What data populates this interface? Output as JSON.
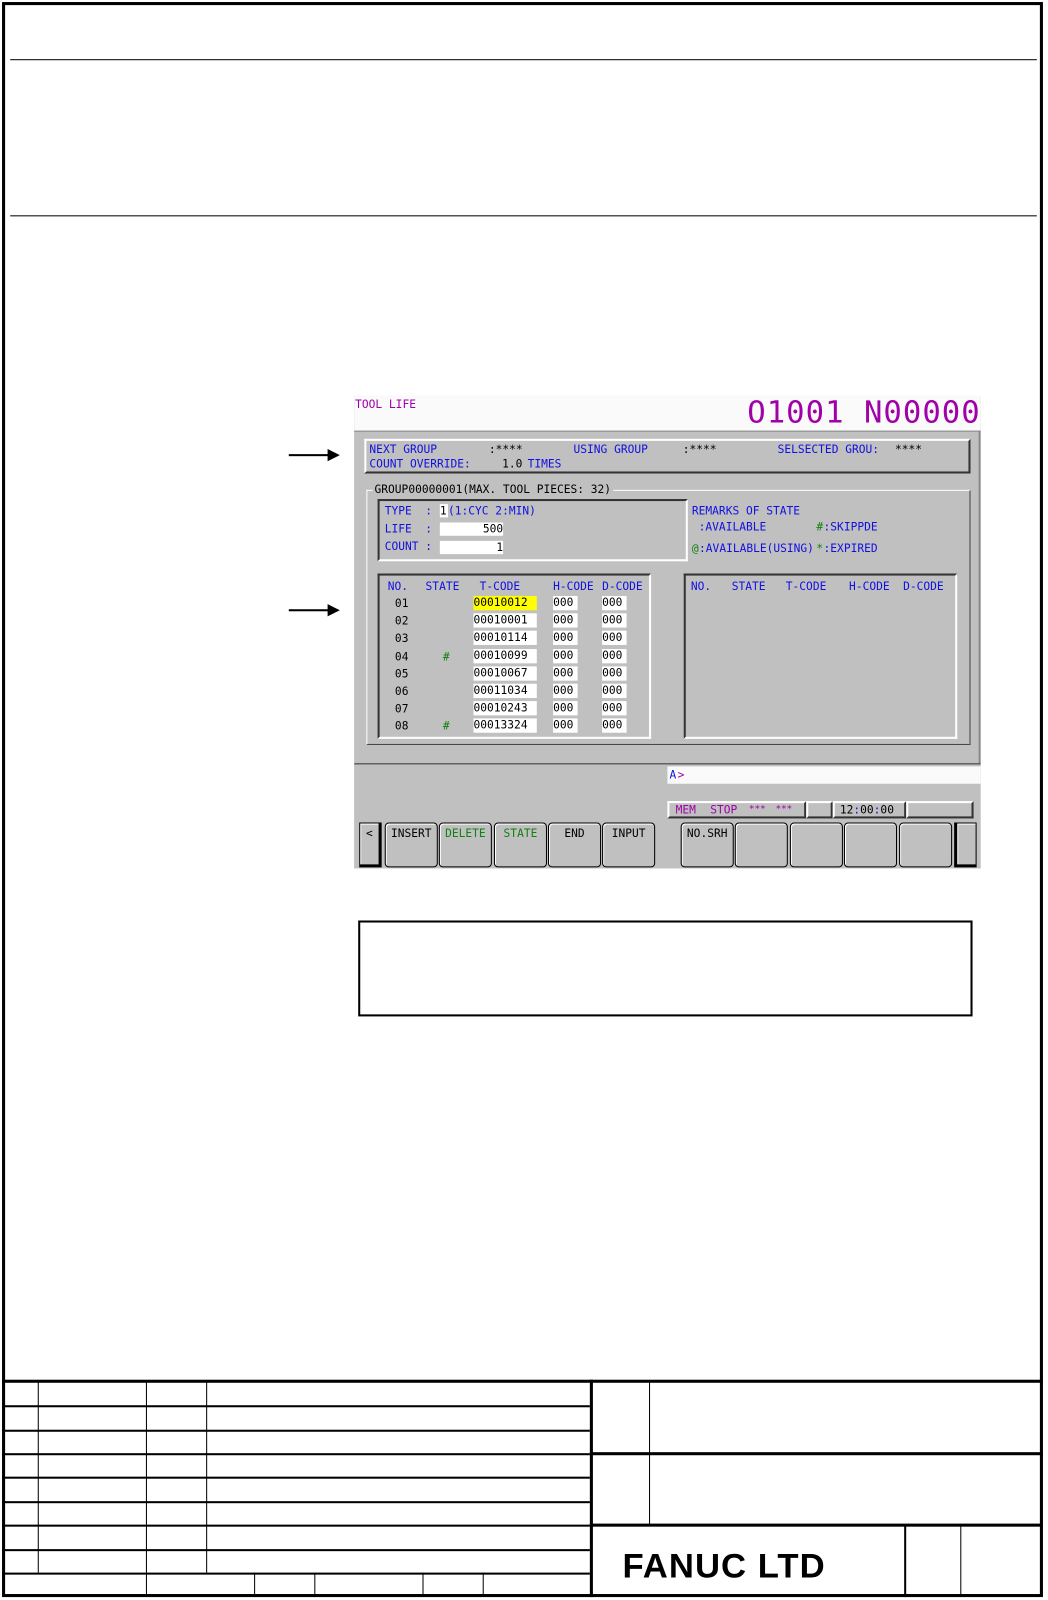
{
  "screen": {
    "title": "TOOL LIFE",
    "program": "O1001 N00000",
    "header": {
      "next_group_label": "NEXT GROUP",
      "next_group_value": ":****",
      "using_group_label": "USING GROUP",
      "using_group_value": ":****",
      "selected_group_label": "SELSECTED GROU:",
      "selected_group_value": "****",
      "count_override_label": "COUNT OVERRIDE:",
      "count_override_value": "1.0",
      "count_override_unit": "TIMES"
    },
    "group_title": "GROUP00000001(MAX. TOOL PIECES: 32)",
    "settings": {
      "type_label": "TYPE  :",
      "type_value": "1",
      "type_hint": "(1:CYC 2:MIN)",
      "life_label": "LIFE  :",
      "life_value": "500",
      "count_label": "COUNT :",
      "count_value": "1"
    },
    "remarks": {
      "title": "REMARKS OF STATE",
      "available": " :AVAILABLE",
      "skipped_symbol": "#",
      "skipped": ":SKIPPDE",
      "using_symbol": "@",
      "using": ":AVAILABLE(USING)",
      "expired_symbol": "*",
      "expired": ":EXPIRED"
    },
    "table_headers": [
      "NO.",
      "STATE",
      "T-CODE",
      "H-CODE",
      "D-CODE"
    ],
    "rows": [
      {
        "no": "01",
        "state": "",
        "t": "00010012",
        "h": "000",
        "d": "000",
        "selected": true
      },
      {
        "no": "02",
        "state": "",
        "t": "00010001",
        "h": "000",
        "d": "000"
      },
      {
        "no": "03",
        "state": "",
        "t": "00010114",
        "h": "000",
        "d": "000"
      },
      {
        "no": "04",
        "state": "#",
        "t": "00010099",
        "h": "000",
        "d": "000"
      },
      {
        "no": "05",
        "state": "",
        "t": "00010067",
        "h": "000",
        "d": "000"
      },
      {
        "no": "06",
        "state": "",
        "t": "00011034",
        "h": "000",
        "d": "000"
      },
      {
        "no": "07",
        "state": "",
        "t": "00010243",
        "h": "000",
        "d": "000"
      },
      {
        "no": "08",
        "state": "#",
        "t": "00013324",
        "h": "000",
        "d": "000"
      }
    ],
    "input_prompt": "A",
    "input_caret": ">",
    "status": {
      "mode": "MEM",
      "state": "STOP",
      "alarm1": "***",
      "alarm2": "***",
      "time_h": "12",
      "time_sep": ":",
      "time_m": "00",
      "time_sep2": ":",
      "time_s": "00"
    },
    "softkeys": {
      "prev": "<",
      "keys": [
        "INSERT",
        "DELETE",
        "STATE",
        "END",
        "INPUT"
      ],
      "keys2": [
        "NO.SRH",
        "",
        "",
        "",
        ""
      ]
    }
  },
  "company": "FANUC LTD",
  "colors": {
    "screen_bg": "#c0c0c0",
    "label_blue": "#1010e0",
    "title_magenta": "#a000a8",
    "state_green": "#108010",
    "selection_yellow": "#ffff00"
  }
}
